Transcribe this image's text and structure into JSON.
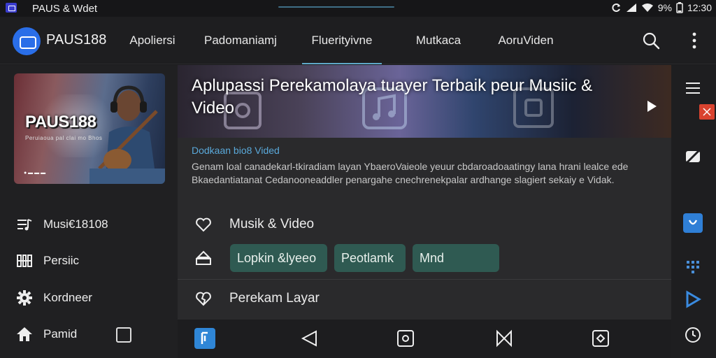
{
  "status_bar": {
    "title": "PAUS & Wdet",
    "battery": "9%",
    "time": "12:30"
  },
  "app_bar": {
    "brand": "PAUS188",
    "tabs": [
      {
        "label": "Apoliersi",
        "active": false
      },
      {
        "label": "Padomaniamj",
        "active": false
      },
      {
        "label": "Fluerityivne",
        "active": true
      },
      {
        "label": "Mutkaca",
        "active": false
      },
      {
        "label": "AoruViden",
        "active": false
      }
    ]
  },
  "sidebar": {
    "card": {
      "title": "PAUS188",
      "subtitle": "Peruiaoua pal clai mo Bhos",
      "footer": "● ▬ ▬ ▬"
    },
    "items": [
      {
        "label": "Musi€18108",
        "icon": "playlist-icon"
      },
      {
        "label": "Persiic",
        "icon": "equalizer-icon"
      },
      {
        "label": "Kordneer",
        "icon": "gear-icon"
      },
      {
        "label": "Pamid",
        "icon": "home-icon"
      }
    ]
  },
  "main": {
    "hero_title": "Aplupassi Perekamolaya tuayer Terbaik peur Musiic & Video",
    "description": {
      "link": "Dodkaan bio8 Vided",
      "text": "Genam loal canadekarl-tkiradiam layan YbaeroVaieole yeuur cbdaroadoaatingy lana hrani lealce ede Bkaedantiatanat Cedanooneaddler penargahe cnechrenekpalar ardhange slagiert sekaiy e Vidak."
    },
    "rows": [
      {
        "label": "Musik & Video",
        "icon": "heart-icon"
      },
      {
        "label": "Perekam Layar",
        "icon": "broken-heart-icon"
      }
    ],
    "chips": [
      "Lopkin &lyeeo",
      "Peotlamk",
      "Mnd"
    ]
  },
  "colors": {
    "accent": "#5fa9c9",
    "chip": "#2f5a52",
    "logo": "#2a6ee8",
    "link": "#5aa9da"
  }
}
